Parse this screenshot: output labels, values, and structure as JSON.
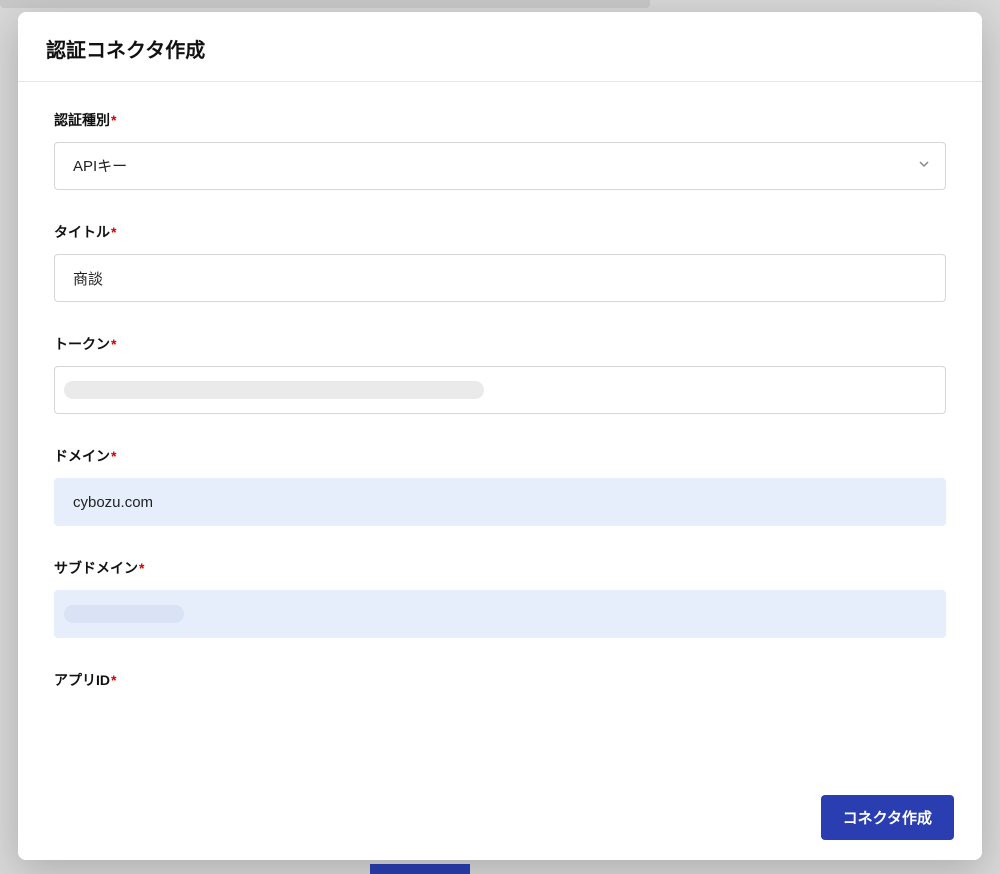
{
  "modal": {
    "title": "認証コネクタ作成"
  },
  "form": {
    "auth_type": {
      "label": "認証種別",
      "value": "APIキー"
    },
    "title": {
      "label": "タイトル",
      "value": "商談"
    },
    "token": {
      "label": "トークン",
      "value": ""
    },
    "domain": {
      "label": "ドメイン",
      "value": "cybozu.com"
    },
    "subdomain": {
      "label": "サブドメイン",
      "value": ""
    },
    "app_id": {
      "label": "アプリID"
    },
    "required_mark": "*"
  },
  "footer": {
    "submit_label": "コネクタ作成"
  }
}
